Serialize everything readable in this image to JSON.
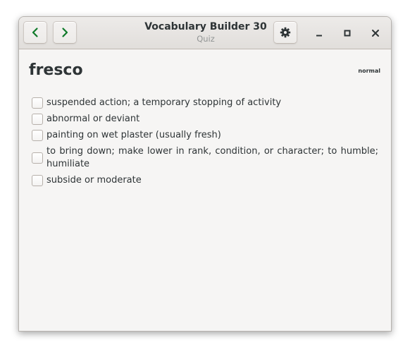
{
  "window": {
    "title": "Vocabulary Builder 30",
    "subtitle": "Quiz"
  },
  "toolbar": {
    "back_icon": "chevron-left-icon",
    "forward_icon": "chevron-right-icon",
    "settings_icon": "gear-icon"
  },
  "quiz": {
    "word": "fresco",
    "level": "normal",
    "options": [
      {
        "label": "suspended action; a temporary stopping of activity",
        "checked": false
      },
      {
        "label": "abnormal or deviant",
        "checked": false
      },
      {
        "label": "painting on wet plaster (usually fresh)",
        "checked": false
      },
      {
        "label": "to bring down; make lower in rank, condition, or character; to humble; humiliate",
        "checked": false
      },
      {
        "label": "subside or moderate",
        "checked": false
      }
    ]
  },
  "colors": {
    "text": "#2e3436",
    "subtitle": "#929595",
    "background": "#f6f5f4",
    "headerbar": "#e8e6e3"
  }
}
